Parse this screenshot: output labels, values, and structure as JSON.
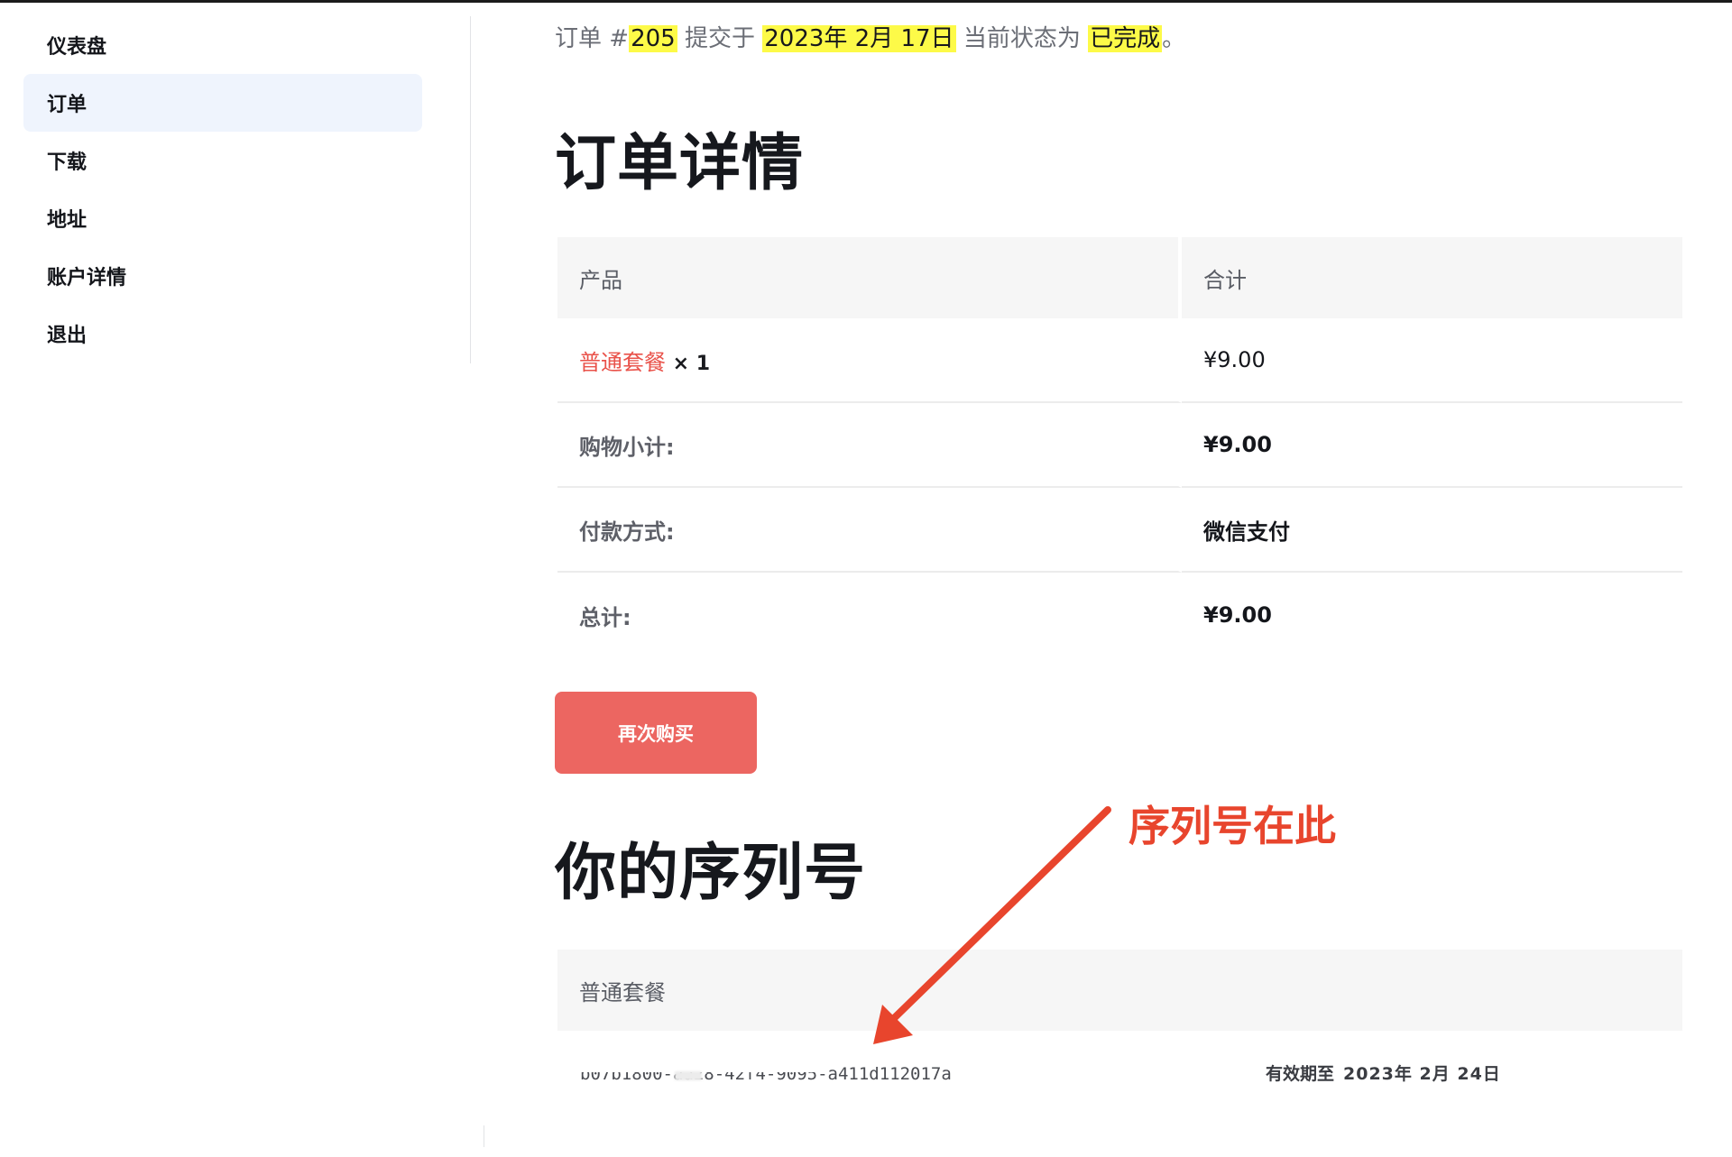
{
  "sidebar": {
    "items": [
      {
        "label": "仪表盘"
      },
      {
        "label": "订单",
        "active": true
      },
      {
        "label": "下载"
      },
      {
        "label": "地址"
      },
      {
        "label": "账户详情"
      },
      {
        "label": "退出"
      }
    ]
  },
  "order": {
    "notice_prefix": "订单 #",
    "number": "205",
    "notice_mid1": " 提交于 ",
    "date": "2023年 2月 17日",
    "notice_mid2": " 当前状态为 ",
    "status": "已完成",
    "notice_suffix": "。"
  },
  "details": {
    "title": "订单详情",
    "headers": {
      "product": "产品",
      "total": "合计"
    },
    "item": {
      "name": "普通套餐",
      "qty": "× 1",
      "price": "¥9.00"
    },
    "rows": [
      {
        "label": "购物小计:",
        "value": "¥9.00"
      },
      {
        "label": "付款方式:",
        "value": "微信支付"
      },
      {
        "label": "总计:",
        "value": "¥9.00"
      }
    ],
    "buy_again_label": "再次购买"
  },
  "serials": {
    "title": "你的序列号",
    "header": "普通套餐",
    "code": "b07b1800-aa28-42f4-9095-a411d112017a",
    "expiry_label": "有效期至",
    "expiry_date": "2023年 2月 24日"
  },
  "annotation": {
    "text": "序列号在此",
    "color": "#e8452d"
  },
  "colors": {
    "accent": "#ec6661",
    "link": "#e9524a",
    "highlight": "#fdfa48",
    "active_nav": "#eff4fd"
  }
}
